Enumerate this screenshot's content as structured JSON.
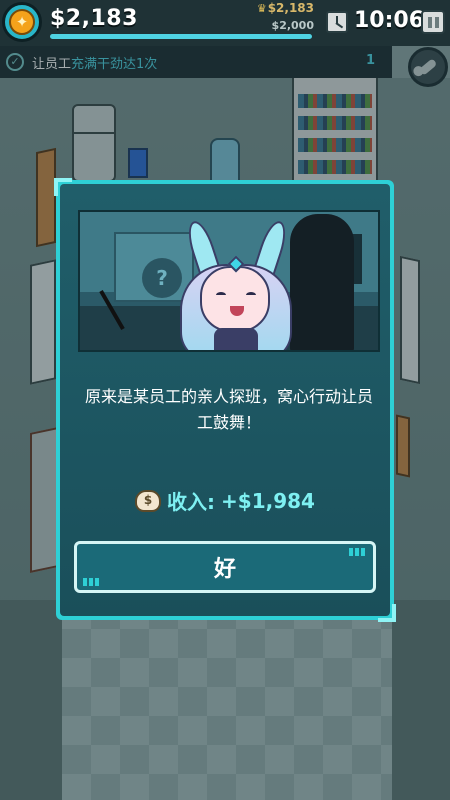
{
  "hud": {
    "money": "$2,183",
    "best": "$2,183",
    "goal": "$2,000",
    "goal_progress": 1.0,
    "time": "10:06"
  },
  "quest": {
    "prefix": "让员工",
    "highlight": "充满干劲达1次",
    "count": "1"
  },
  "dialog": {
    "message": "原来是某员工的亲人探班，窝心行动让员工鼓舞！",
    "income_label": "收入:",
    "income_value": "+$1,984",
    "ok_label": "好"
  },
  "colors": {
    "accent": "#2ed0d6",
    "income": "#7ef0f2",
    "hud_bg": "#1f3236"
  },
  "icons": {
    "coin": "coin-flame-icon",
    "clock": "clock-icon",
    "pause": "pause-icon",
    "quest": "check-circle-icon",
    "tool": "wrench-icon",
    "bag": "money-bag-icon"
  }
}
